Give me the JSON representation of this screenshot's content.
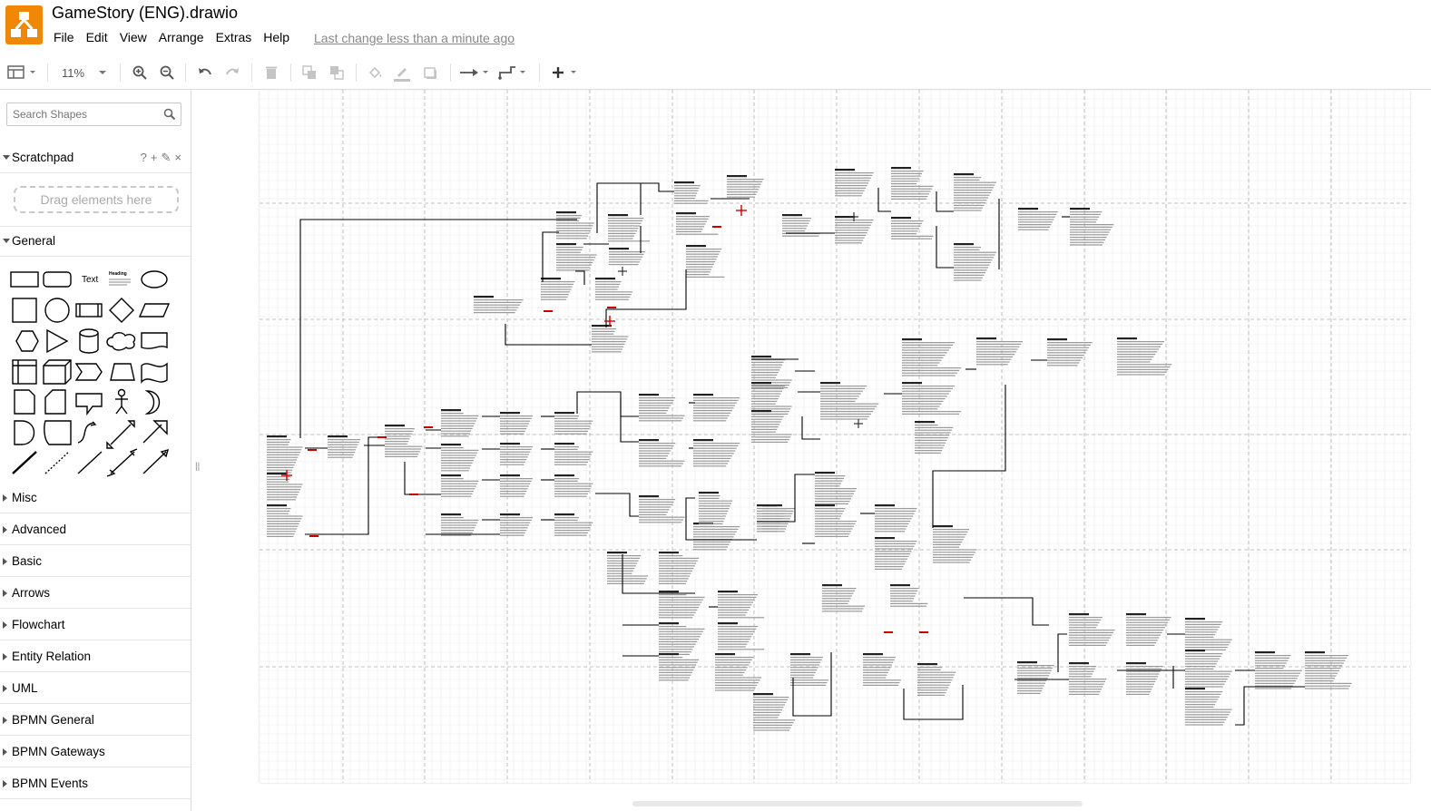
{
  "app": {
    "title": "GameStory (ENG).drawio",
    "last_change": "Last change less than a minute ago",
    "logo_color": "#f08705"
  },
  "menu": [
    "File",
    "Edit",
    "View",
    "Arrange",
    "Extras",
    "Help"
  ],
  "toolbar": {
    "zoom": "11%",
    "buttons": [
      "format-panel-icon",
      "zoom-in-icon",
      "zoom-out-icon",
      "undo-icon",
      "redo-icon",
      "delete-icon",
      "to-front-icon",
      "to-back-icon",
      "fill-color-icon",
      "line-color-icon",
      "shadow-icon",
      "connection-icon",
      "waypoints-icon",
      "insert-icon"
    ]
  },
  "sidebar": {
    "search_placeholder": "Search Shapes",
    "scratchpad": {
      "label": "Scratchpad",
      "tools": [
        "?",
        "+",
        "✎",
        "×"
      ],
      "drop_hint": "Drag elements here"
    },
    "general_label": "General",
    "general_shape_texts": [
      "Text",
      "Heading"
    ],
    "sections": [
      "Misc",
      "Advanced",
      "Basic",
      "Arrows",
      "Flowchart",
      "Entity Relation",
      "UML",
      "BPMN General",
      "BPMN Gateways",
      "BPMN Events"
    ]
  },
  "colors": {
    "grid": "#e8e8e8",
    "page_break": "#b0b0b0",
    "connector": "#000000",
    "marker": "#cc0000"
  }
}
